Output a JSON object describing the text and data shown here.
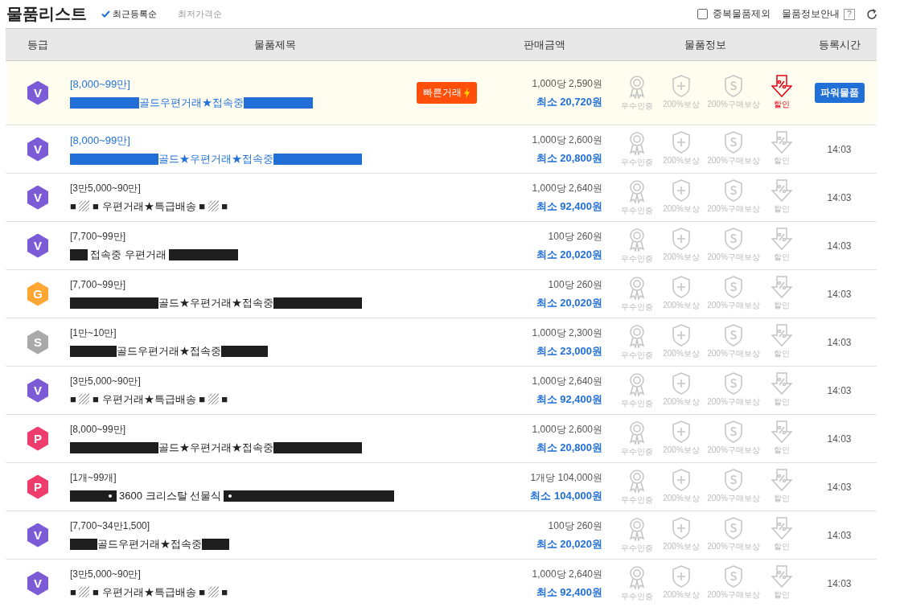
{
  "title": "물품리스트",
  "sort_options": [
    {
      "label": "최근등록순",
      "selected": true
    },
    {
      "label": "최저가격순",
      "selected": false
    }
  ],
  "exclude_duplicates": {
    "label": "중복물품제외",
    "checked": false
  },
  "info_guide": {
    "label": "물품정보안내",
    "help": "?"
  },
  "table": {
    "columns": [
      "등급",
      "물품제목",
      "판매금액",
      "물품정보",
      "등록시간"
    ],
    "rows": [
      {
        "grade": "V",
        "color": "#7b5cd6",
        "featured": true,
        "highlighted": true,
        "range": "[8,000~99만]",
        "parts": [
          {
            "kind": "long"
          },
          {
            "kind": "text",
            "text": "골드우편거래★접속중"
          },
          {
            "kind": "long"
          }
        ],
        "fast_trade": "빠른거래",
        "unit_price": "1,000당 2,590원",
        "min_price": "최소 20,720원",
        "info": [
          {
            "kind": "award",
            "label": "우수인증",
            "active": false
          },
          {
            "kind": "shield",
            "label": "200%보상",
            "active": false
          },
          {
            "kind": "coin",
            "label": "200%구매보상",
            "active": false
          },
          {
            "kind": "discount",
            "label": "할인",
            "active": true
          }
        ],
        "power": "파워물품"
      },
      {
        "grade": "V",
        "color": "#7b5cd6",
        "featured": false,
        "highlighted": true,
        "range": "[8,000~99만]",
        "parts": [
          {
            "kind": "wide"
          },
          {
            "kind": "text",
            "text": "골드★우편거래★접속중"
          },
          {
            "kind": "wide"
          }
        ],
        "unit_price": "1,000당 2,600원",
        "min_price": "최소 20,800원",
        "info": [
          {
            "kind": "award",
            "label": "우수인증",
            "active": false
          },
          {
            "kind": "shield",
            "label": "200%보상",
            "active": false
          },
          {
            "kind": "coin",
            "label": "200%구매보상",
            "active": false
          },
          {
            "kind": "discount",
            "label": "할인",
            "active": false
          }
        ],
        "time": "14:03"
      },
      {
        "grade": "V",
        "color": "#7b5cd6",
        "featured": false,
        "highlighted": false,
        "range": "[3만5,000~90만]",
        "parts": [
          {
            "kind": "text",
            "text": "■ ▨ ■ 우편거래★특급배송 ■ ▨ ■"
          }
        ],
        "unit_price": "1,000당 2,640원",
        "min_price": "최소 92,400원",
        "info": [
          {
            "kind": "award",
            "label": "우수인증",
            "active": false
          },
          {
            "kind": "shield",
            "label": "200%보상",
            "active": false
          },
          {
            "kind": "coin",
            "label": "200%구매보상",
            "active": false
          },
          {
            "kind": "discount",
            "label": "할인",
            "active": false
          }
        ],
        "time": "14:03"
      },
      {
        "grade": "V",
        "color": "#7b5cd6",
        "featured": false,
        "highlighted": false,
        "range": "[7,700~99만]",
        "parts": [
          {
            "kind": "tiny"
          },
          {
            "kind": "text",
            "text": "접속중 우편거래"
          },
          {
            "kind": "long"
          }
        ],
        "unit_price": "100당 260원",
        "min_price": "최소 20,020원",
        "info": [
          {
            "kind": "award",
            "label": "우수인증",
            "active": false
          },
          {
            "kind": "shield",
            "label": "200%보상",
            "active": false
          },
          {
            "kind": "coin",
            "label": "200%구매보상",
            "active": false
          },
          {
            "kind": "discount",
            "label": "할인",
            "active": false
          }
        ],
        "time": "14:03"
      },
      {
        "grade": "G",
        "color": "#ffa633",
        "featured": false,
        "highlighted": false,
        "range": "[7,700~99만]",
        "parts": [
          {
            "kind": "wide"
          },
          {
            "kind": "text",
            "text": "골드★우편거래★접속중"
          },
          {
            "kind": "wide"
          }
        ],
        "unit_price": "100당 260원",
        "min_price": "최소 20,020원",
        "info": [
          {
            "kind": "award",
            "label": "우수인증",
            "active": false
          },
          {
            "kind": "shield",
            "label": "200%보상",
            "active": false
          },
          {
            "kind": "coin",
            "label": "200%구매보상",
            "active": false
          },
          {
            "kind": "discount",
            "label": "할인",
            "active": false
          }
        ],
        "time": "14:03"
      },
      {
        "grade": "S",
        "color": "#a9a9a9",
        "featured": false,
        "highlighted": false,
        "range": "[1만~10만]",
        "parts": [
          {
            "kind": "medium"
          },
          {
            "kind": "text",
            "text": "골드우편거래★접속중"
          },
          {
            "kind": "medium"
          }
        ],
        "unit_price": "1,000당 2,300원",
        "min_price": "최소 23,000원",
        "info": [
          {
            "kind": "award",
            "label": "우수인증",
            "active": false
          },
          {
            "kind": "shield",
            "label": "200%보상",
            "active": false
          },
          {
            "kind": "coin",
            "label": "200%구매보상",
            "active": false
          },
          {
            "kind": "discount",
            "label": "할인",
            "active": false
          }
        ],
        "time": "14:03"
      },
      {
        "grade": "V",
        "color": "#7b5cd6",
        "featured": false,
        "highlighted": false,
        "range": "[3만5,000~90만]",
        "parts": [
          {
            "kind": "text",
            "text": "■ ▨ ■ 우편거래★특급배송 ■ ▨ ■"
          }
        ],
        "unit_price": "1,000당 2,640원",
        "min_price": "최소 92,400원",
        "info": [
          {
            "kind": "award",
            "label": "우수인증",
            "active": false
          },
          {
            "kind": "shield",
            "label": "200%보상",
            "active": false
          },
          {
            "kind": "coin",
            "label": "200%구매보상",
            "active": false
          },
          {
            "kind": "discount",
            "label": "할인",
            "active": false
          }
        ],
        "time": "14:03"
      },
      {
        "grade": "P",
        "color": "#ee3d6c",
        "featured": false,
        "highlighted": false,
        "range": "[8,000~99만]",
        "parts": [
          {
            "kind": "wide"
          },
          {
            "kind": "text",
            "text": "골드★우편거래★접속중"
          },
          {
            "kind": "wide"
          }
        ],
        "unit_price": "1,000당 2,600원",
        "min_price": "최소 20,800원",
        "info": [
          {
            "kind": "award",
            "label": "우수인증",
            "active": false
          },
          {
            "kind": "shield",
            "label": "200%보상",
            "active": false
          },
          {
            "kind": "coin",
            "label": "200%구매보상",
            "active": false
          },
          {
            "kind": "discount",
            "label": "할인",
            "active": false
          }
        ],
        "time": "14:03"
      },
      {
        "grade": "P",
        "color": "#ee3d6c",
        "featured": false,
        "highlighted": false,
        "range": "[1개~99개]",
        "parts": [
          {
            "kind": "medium",
            "dot_end": true
          },
          {
            "kind": "text",
            "text": "3600 크리스탈 선물식"
          },
          {
            "kind": "huge",
            "dot_start": true
          }
        ],
        "unit_price": "1개당 104,000원",
        "min_price": "최소 104,000원",
        "info": [
          {
            "kind": "award",
            "label": "우수인증",
            "active": false
          },
          {
            "kind": "shield",
            "label": "200%보상",
            "active": false
          },
          {
            "kind": "coin",
            "label": "200%구매보상",
            "active": false
          },
          {
            "kind": "discount",
            "label": "할인",
            "active": false
          }
        ],
        "time": "14:03"
      },
      {
        "grade": "V",
        "color": "#7b5cd6",
        "featured": false,
        "highlighted": false,
        "range": "[7,700~34만1,500]",
        "parts": [
          {
            "kind": "short"
          },
          {
            "kind": "text",
            "text": "골드우편거래★접속중"
          },
          {
            "kind": "short"
          }
        ],
        "unit_price": "100당 260원",
        "min_price": "최소 20,020원",
        "info": [
          {
            "kind": "award",
            "label": "우수인증",
            "active": false
          },
          {
            "kind": "shield",
            "label": "200%보상",
            "active": false
          },
          {
            "kind": "coin",
            "label": "200%구매보상",
            "active": false
          },
          {
            "kind": "discount",
            "label": "할인",
            "active": false
          }
        ],
        "time": "14:03"
      },
      {
        "grade": "V",
        "color": "#7b5cd6",
        "featured": false,
        "highlighted": false,
        "range": "[3만5,000~90만]",
        "parts": [
          {
            "kind": "text",
            "text": "■ ▨ ■ 우편거래★특급배송 ■ ▨ ■"
          }
        ],
        "unit_price": "1,000당 2,640원",
        "min_price": "최소 92,400원",
        "info": [
          {
            "kind": "award",
            "label": "우수인증",
            "active": false
          },
          {
            "kind": "shield",
            "label": "200%보상",
            "active": false
          },
          {
            "kind": "coin",
            "label": "200%구매보상",
            "active": false
          },
          {
            "kind": "discount",
            "label": "할인",
            "active": false
          }
        ],
        "time": "14:03"
      }
    ]
  }
}
